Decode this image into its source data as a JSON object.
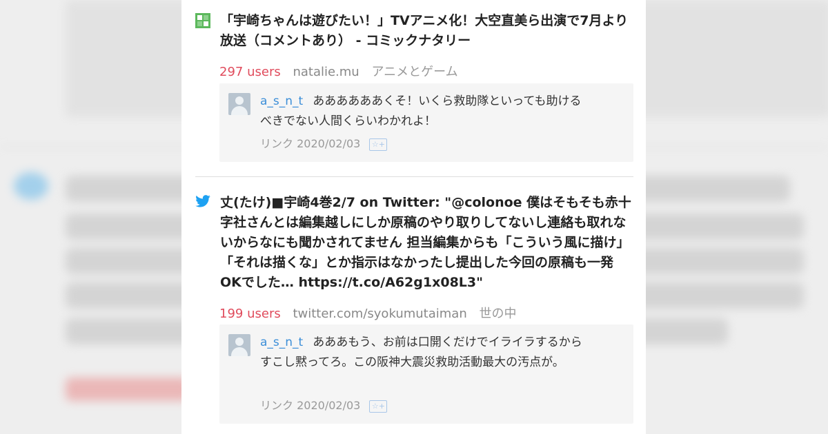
{
  "entries": [
    {
      "favicon": "natalie-icon",
      "title": "「宇崎ちゃんは遊びたい！」TVアニメ化！大空直美ら出演で7月より放送（コメントあり） - コミックナタリー",
      "users": "297 users",
      "domain": "natalie.mu",
      "category": "アニメとゲーム",
      "comment": {
        "user": "a_s_n_t",
        "text": "ああああああくそ！いくら救助隊といっても助けるべきでない人間くらいわかれよ！",
        "link_label": "リンク",
        "date": "2020/02/03",
        "star_icon": "add-star-icon"
      }
    },
    {
      "favicon": "twitter-bird-icon",
      "title": "丈(たけ)■宇崎4巻2/7 on Twitter: \"@colonoe 僕はそもそも赤十字社さんとは編集越しにしか原稿のやり取りしてないし連絡も取れないからなにも聞かされてません 担当編集からも「こういう風に描け」「それは描くな」とか指示はなかったし提出した今回の原稿も一発OKでした… https://t.co/A62g1x08L3\"",
      "users": "199 users",
      "domain": "twitter.com/syokumutaiman",
      "category": "世の中",
      "comment": {
        "user": "a_s_n_t",
        "text": "あああもう、お前は口開くだけでイライラするからすこし黙ってろ。この阪神大震災救助活動最大の汚点が。",
        "link_label": "リンク",
        "date": "2020/02/03",
        "star_icon": "add-star-icon"
      }
    }
  ],
  "colors": {
    "users": "#e04b5c",
    "comment_user": "#3b8ed8",
    "twitter": "#1da1f2",
    "natalie": "#4caf50"
  }
}
